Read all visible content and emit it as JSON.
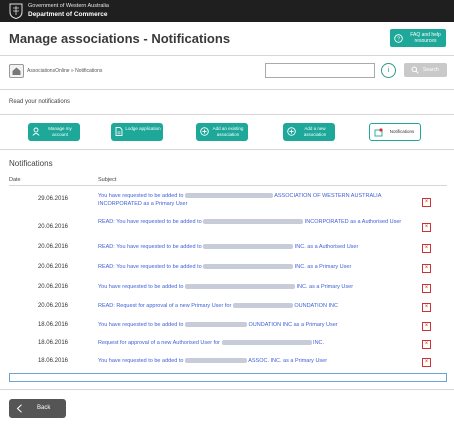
{
  "header": {
    "gov_line1": "Government of Western Australia",
    "gov_line2": "Department of Commerce",
    "crest_icon": "wa-crest-icon"
  },
  "page": {
    "title": "Manage associations - Notifications",
    "help_button": "FAQ and help resources"
  },
  "breadcrumb": {
    "home_icon": "home-icon",
    "path": "AssociationsOnline » Notifications"
  },
  "search": {
    "value": "",
    "placeholder": "",
    "button_label": "Search",
    "info_icon": "info-icon"
  },
  "section_label": "Read your notifications",
  "actions": [
    {
      "label": "Manage my account",
      "icon": "user-icon"
    },
    {
      "label": "Lodge application",
      "icon": "document-icon"
    },
    {
      "label": "Add an existing association",
      "icon": "plus-circle-icon"
    },
    {
      "label": "Add a new association",
      "icon": "plus-circle-icon"
    },
    {
      "label": "Notifications",
      "icon": "notification-icon"
    }
  ],
  "notifications": {
    "title": "Notifications",
    "columns": {
      "date": "Date",
      "subject": "Subject"
    },
    "rows": [
      {
        "date": "29.06.2016",
        "prefix": "You have requested to be added to",
        "suffix": "ASSOCIATION OF WESTERN AUSTRALIA INCORPORATED as a Primary User"
      },
      {
        "date": "20.06.2016",
        "prefix": "READ: You have requested to be added to",
        "suffix": "INCORPORATED as a Authorised User"
      },
      {
        "date": "20.06.2016",
        "prefix": "READ: You have requested to be added to",
        "suffix": "INC. as a Authorised User"
      },
      {
        "date": "20.06.2016",
        "prefix": "READ: You have requested to be added to",
        "suffix": "INC. as a Primary User"
      },
      {
        "date": "20.06.2016",
        "prefix": "You have requested to be added to",
        "suffix": "INC. as a Primary User"
      },
      {
        "date": "20.06.2016",
        "prefix": "READ: Request for approval of a new Primary User for",
        "suffix": "OUNDATION INC"
      },
      {
        "date": "18.06.2016",
        "prefix": "You have requested to be added to",
        "suffix": "OUNDATION INC as a Primary User"
      },
      {
        "date": "18.06.2016",
        "prefix": "Request for approval of a new Authorised User for",
        "suffix": "INC."
      },
      {
        "date": "18.06.2016",
        "prefix": "You have requested to be added to",
        "suffix": "ASSOC. INC. as a Primary User"
      }
    ],
    "delete_icon": "delete-icon"
  },
  "footer": {
    "back_label": "Back",
    "back_icon": "chevron-left-icon"
  },
  "colors": {
    "teal": "#1da89a",
    "link": "#3f5fd6",
    "topbar": "#1f1f1f",
    "delete": "#cc3333"
  }
}
